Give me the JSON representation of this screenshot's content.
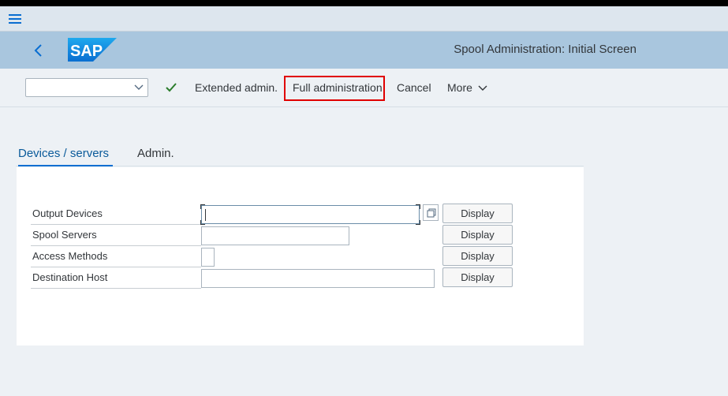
{
  "shell": {
    "menu_icon": "hamburger-icon",
    "back_icon": "chevron-left-icon",
    "logo_text": "SAP",
    "title": "Spool Administration: Initial Screen",
    "brand_color": "#0a6ed1"
  },
  "toolbar": {
    "dropdown_value": "",
    "check_icon": "checkmark-icon",
    "extended_admin_label": "Extended admin.",
    "full_admin_label": "Full administration",
    "cancel_label": "Cancel",
    "more_label": "More"
  },
  "tabs": [
    {
      "label": "Devices / servers",
      "active": true
    },
    {
      "label": "Admin.",
      "active": false
    }
  ],
  "form": {
    "rows": [
      {
        "label": "Output Devices",
        "value": "",
        "button": "Display"
      },
      {
        "label": "Spool Servers",
        "value": "",
        "button": "Display"
      },
      {
        "label": "Access Methods",
        "value": "",
        "button": "Display"
      },
      {
        "label": "Destination Host",
        "value": "",
        "button": "Display"
      }
    ]
  }
}
